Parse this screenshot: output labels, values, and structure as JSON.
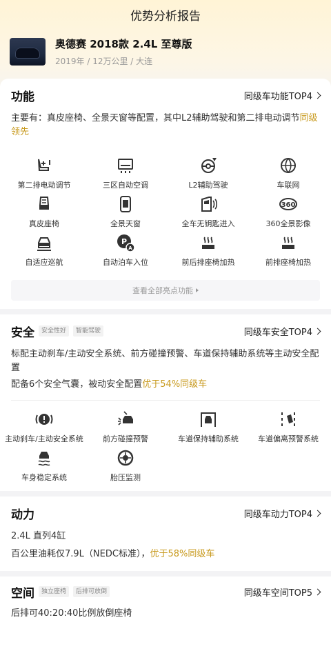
{
  "header": {
    "title": "优势分析报告"
  },
  "car": {
    "title": "奥德赛 2018款 2.4L 至尊版",
    "subtitle": "2019年 / 12万公里 / 大连"
  },
  "function": {
    "title": "功能",
    "top_link": "同级车功能TOP4",
    "desc_main": "主要有：真皮座椅、全景天窗等配置，其中L2辅助驾驶和第二排电动调节",
    "desc_highlight": "同级领先",
    "items": [
      {
        "label": "第二排电动调节",
        "icon": "power-seat-icon"
      },
      {
        "label": "三区自动空调",
        "icon": "air-conditioner-icon"
      },
      {
        "label": "L2辅助驾驶",
        "icon": "steering-assist-icon"
      },
      {
        "label": "车联网",
        "icon": "connected-car-icon"
      },
      {
        "label": "真皮座椅",
        "icon": "leather-seat-icon"
      },
      {
        "label": "全景天窗",
        "icon": "panoramic-sunroof-icon"
      },
      {
        "label": "全车无钥匙进入",
        "icon": "keyless-entry-icon"
      },
      {
        "label": "360全景影像",
        "icon": "360-camera-icon"
      },
      {
        "label": "自适应巡航",
        "icon": "adaptive-cruise-icon"
      },
      {
        "label": "自动泊车入位",
        "icon": "auto-parking-icon"
      },
      {
        "label": "前后排座椅加热",
        "icon": "seat-heating-icon"
      },
      {
        "label": "前排座椅加热",
        "icon": "front-seat-heating-icon"
      }
    ],
    "more_label": "查看全部亮点功能"
  },
  "safety": {
    "title": "安全",
    "tags": [
      "安全性好",
      "智能驾驶"
    ],
    "top_link": "同级车安全TOP4",
    "desc1": "标配主动刹车/主动安全系统、前方碰撞预警、车道保持辅助系统等主动安全配置",
    "desc2_main": "配备6个安全气囊，被动安全配置",
    "desc2_highlight": "优于54%同级车",
    "items": [
      {
        "label": "主动刹车/主动安全系统",
        "icon": "active-brake-icon"
      },
      {
        "label": "前方碰撞预警",
        "icon": "collision-warning-icon"
      },
      {
        "label": "车道保持辅助系统",
        "icon": "lane-keep-icon"
      },
      {
        "label": "车道偏离预警系统",
        "icon": "lane-departure-icon"
      },
      {
        "label": "车身稳定系统",
        "icon": "stability-control-icon"
      },
      {
        "label": "胎压监测",
        "icon": "tire-pressure-icon"
      }
    ]
  },
  "power": {
    "title": "动力",
    "top_link": "同级车动力TOP4",
    "line1": "2.4L 直列4缸",
    "line2_main": "百公里油耗仅7.9L（NEDC标准），",
    "line2_highlight": "优于58%同级车"
  },
  "space": {
    "title": "空间",
    "tags": [
      "独立座椅",
      "后排可放倒"
    ],
    "top_link": "同级车空间TOP5",
    "line1": "后排可40:20:40比例放倒座椅"
  },
  "colors": {
    "accent": "#c89a1e",
    "icon": "#333333"
  }
}
